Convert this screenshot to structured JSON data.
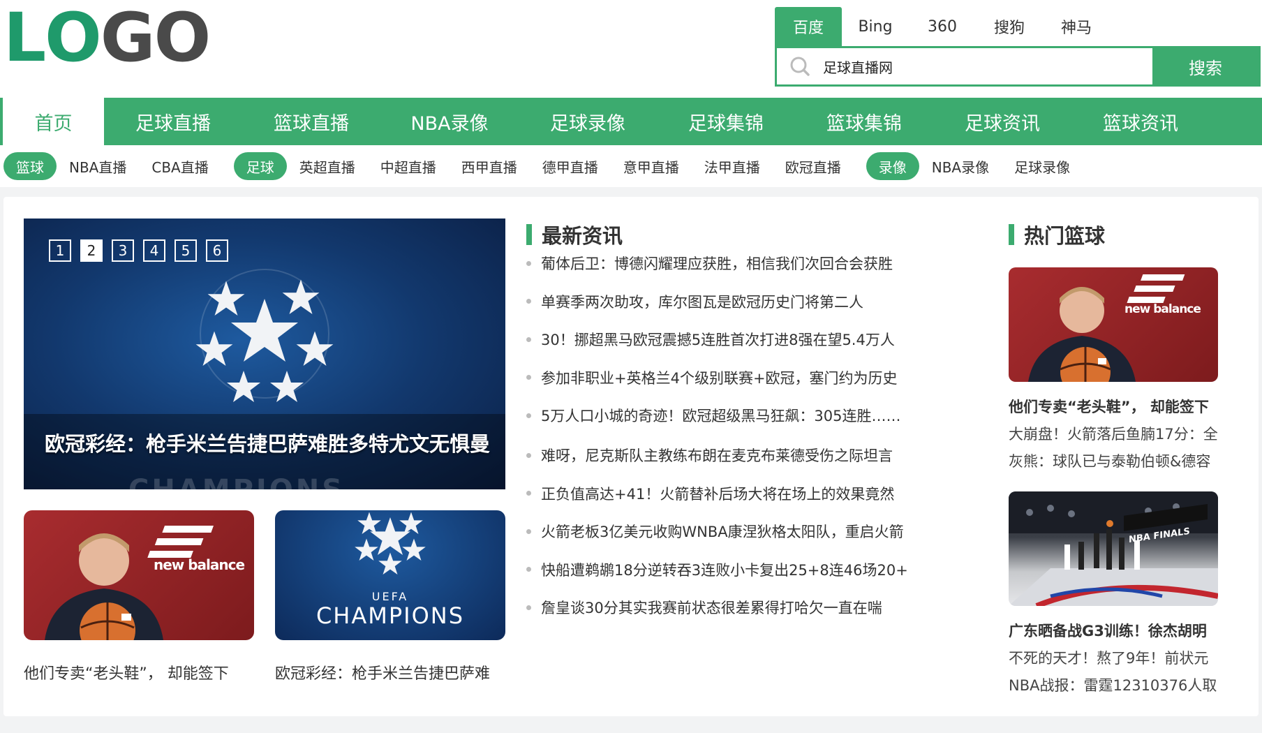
{
  "logo": {
    "text_a": "L",
    "text_b": "O",
    "text_c": "G",
    "text_d": "O"
  },
  "search": {
    "engines": [
      "百度",
      "Bing",
      "360",
      "搜狗",
      "神马"
    ],
    "active_engine": 0,
    "query": "足球直播网",
    "button": "搜索"
  },
  "main_nav": [
    "首页",
    "足球直播",
    "篮球直播",
    "NBA录像",
    "足球录像",
    "足球集锦",
    "篮球集锦",
    "足球资讯",
    "篮球资讯"
  ],
  "sub_nav": {
    "groups": [
      {
        "pill": "篮球",
        "links": [
          "NBA直播",
          "CBA直播"
        ]
      },
      {
        "pill": "足球",
        "links": [
          "英超直播",
          "中超直播",
          "西甲直播",
          "德甲直播",
          "意甲直播",
          "法甲直播",
          "欧冠直播"
        ]
      },
      {
        "pill": "录像",
        "links": [
          "NBA录像",
          "足球录像"
        ]
      }
    ]
  },
  "slider": {
    "pages": [
      "1",
      "2",
      "3",
      "4",
      "5",
      "6"
    ],
    "active_page": 1,
    "caption": "欧冠彩经：枪手米兰告捷巴萨难胜多特尤文无惧曼",
    "champ_text": "CHAMPIONS"
  },
  "thumbs": [
    {
      "caption": "他们专卖“老头鞋”， 却能签下",
      "brand": "new balance"
    },
    {
      "caption": "欧冠彩经：枪手米兰告捷巴萨难",
      "badge_top": "UEFA",
      "badge": "CHAMPIONS"
    }
  ],
  "latest": {
    "title": "最新资讯",
    "group1": [
      "葡体后卫：博德闪耀理应获胜，相信我们次回合会获胜",
      "单赛季两次助攻，库尔图瓦是欧冠历史门将第二人",
      "30！挪超黑马欧冠震撼5连胜首次打进8强在望5.4万人",
      "参加非职业+英格兰4个级别联赛+欧冠，塞门约为历史",
      "5万人口小城的奇迹！欧冠超级黑马狂飙：305连胜……"
    ],
    "group2": [
      "难呀，尼克斯队主教练布朗在麦克布莱德受伤之际坦言",
      "正负值高达+41！火箭替补后场大将在场上的效果竟然",
      "火箭老板3亿美元收购WNBA康涅狄格太阳队，重启火箭",
      "快船遭鹈鹕18分逆转吞3连败小卡复出25+8连46场20+",
      "詹皇谈30分其实我赛前状态很差累得打哈欠一直在喘"
    ]
  },
  "hot": {
    "title": "热门篮球",
    "items": [
      {
        "title": "他们专卖“老头鞋”， 却能签下",
        "brand": "new balance",
        "lines": [
          "大崩盘！火箭落后鱼腩17分：全",
          "灰熊：球队已与泰勒伯顿&德容"
        ]
      },
      {
        "title": "广东晒备战G3训练！徐杰胡明",
        "banner": "NBA FINALS",
        "lines": [
          "不死的天才！熬了9年！前状元",
          "NBA战报：雷霆12310376人取"
        ]
      }
    ]
  },
  "colors": {
    "accent": "#3cab6f",
    "logo_green": "#1f9a6b",
    "logo_gray": "#4a4a4a"
  }
}
